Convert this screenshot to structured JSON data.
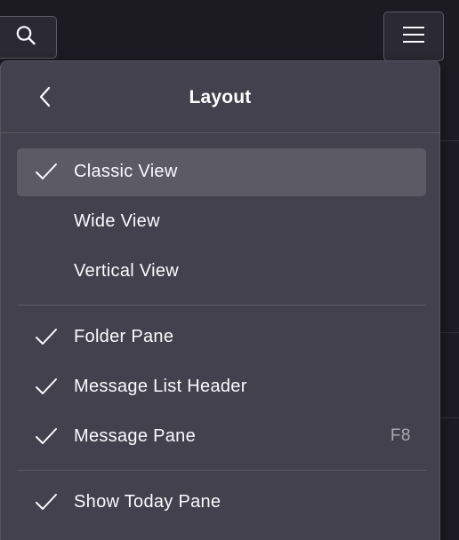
{
  "toolbar": {
    "search_icon": "search-icon",
    "menu_icon": "hamburger-menu-icon"
  },
  "panel": {
    "title": "Layout",
    "back_icon": "chevron-left-icon",
    "view_items": [
      {
        "label": "Classic View",
        "checked": true,
        "selected": true
      },
      {
        "label": "Wide View",
        "checked": false,
        "selected": false
      },
      {
        "label": "Vertical View",
        "checked": false,
        "selected": false
      }
    ],
    "pane_items": [
      {
        "label": "Folder Pane",
        "checked": true
      },
      {
        "label": "Message List Header",
        "checked": true
      },
      {
        "label": "Message Pane",
        "checked": true,
        "shortcut": "F8"
      }
    ],
    "today_items": [
      {
        "label": "Show Today Pane",
        "checked": true
      }
    ]
  },
  "colors": {
    "panel_bg": "#42414d",
    "selected_bg": "#5b5a65",
    "text": "#fbfbfe",
    "shortcut_text": "#a9a8b0"
  }
}
